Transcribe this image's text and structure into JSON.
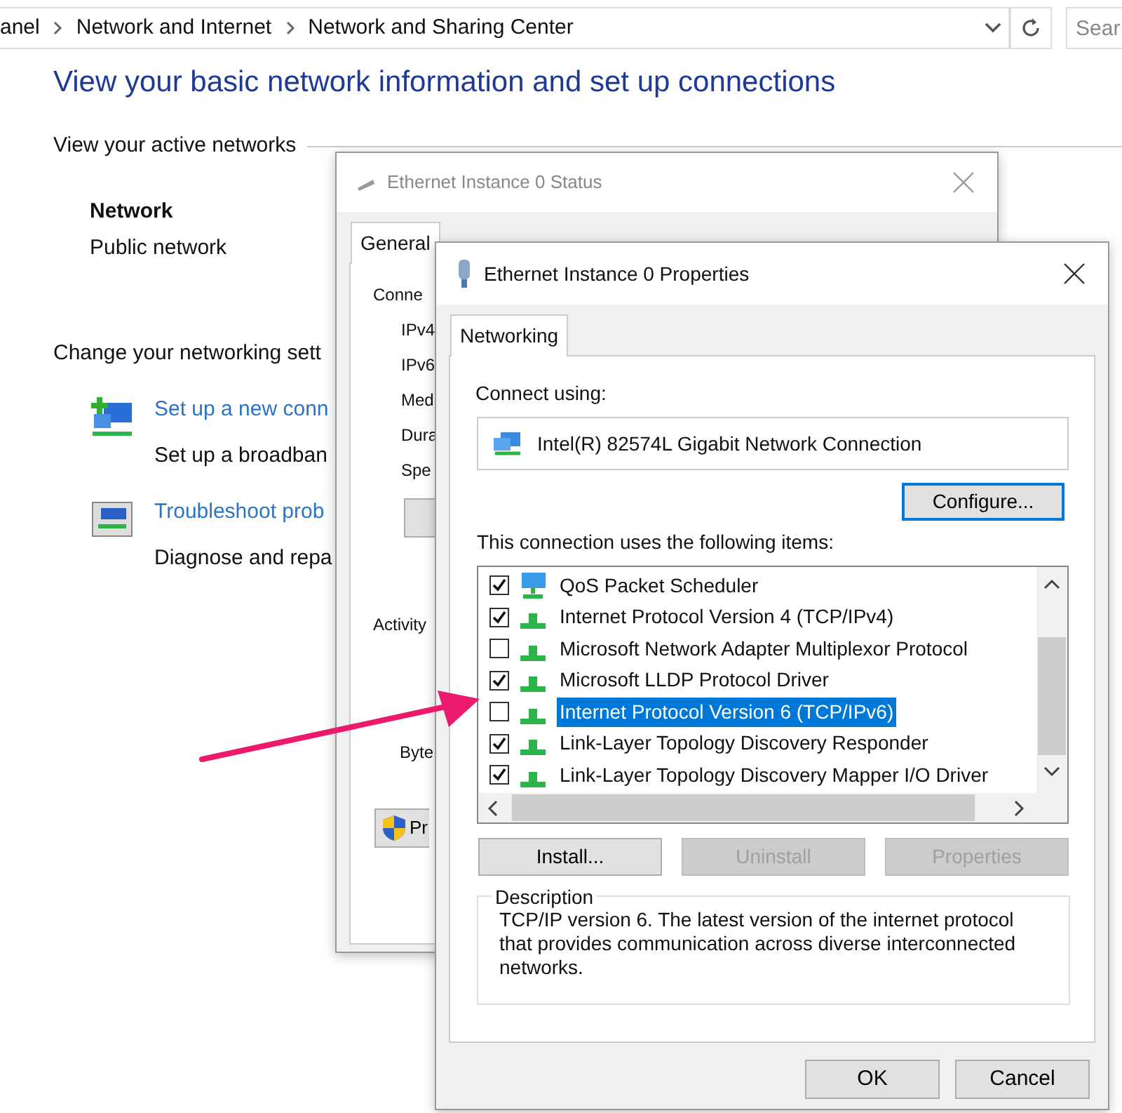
{
  "address_bar": {
    "breadcrumbs": [
      "anel",
      "Network and Internet",
      "Network and Sharing Center"
    ],
    "search_placeholder": "Sear"
  },
  "page": {
    "heading": "View your basic network information and set up connections",
    "active_networks_label": "View your active networks",
    "network": {
      "name": "Network",
      "type": "Public network"
    },
    "change_settings_label": "Change your networking sett",
    "tasks": [
      {
        "kind": "add",
        "link": "Set up a new conn",
        "description": "Set up a broadban"
      },
      {
        "kind": "repair",
        "link": "Troubleshoot prob",
        "description": "Diagnose and repa"
      }
    ]
  },
  "status_dialog": {
    "title": "Ethernet Instance 0 Status",
    "tabs": [
      {
        "label": "General",
        "selected": true
      }
    ],
    "section_label": "Conne",
    "rows": [
      "IPv4",
      "IPv6",
      "Med",
      "Dura",
      "Spe"
    ],
    "activity_label": "Activity",
    "bytes_label": "Byte",
    "shield_button": "Pr"
  },
  "properties_dialog": {
    "title": "Ethernet Instance 0 Properties",
    "tabs": [
      {
        "label": "Networking",
        "selected": true
      }
    ],
    "connect_using_label": "Connect using:",
    "adapter": "Intel(R) 82574L Gigabit Network Connection",
    "configure_button": {
      "label": "Configure...",
      "focused": true
    },
    "items_label": "This connection uses the following items:",
    "items": [
      {
        "kind": "service",
        "label": "QoS Packet Scheduler",
        "checked": true,
        "selected": false
      },
      {
        "kind": "protocol",
        "label": "Internet Protocol Version 4 (TCP/IPv4)",
        "checked": true,
        "selected": false
      },
      {
        "kind": "protocol",
        "label": "Microsoft Network Adapter Multiplexor Protocol",
        "checked": false,
        "selected": false
      },
      {
        "kind": "protocol",
        "label": "Microsoft LLDP Protocol Driver",
        "checked": true,
        "selected": false
      },
      {
        "kind": "protocol",
        "label": "Internet Protocol Version 6 (TCP/IPv6)",
        "checked": false,
        "selected": true
      },
      {
        "kind": "protocol",
        "label": "Link-Layer Topology Discovery Responder",
        "checked": true,
        "selected": false
      },
      {
        "kind": "protocol",
        "label": "Link-Layer Topology Discovery Mapper I/O Driver",
        "checked": true,
        "selected": false
      }
    ],
    "item_buttons": [
      {
        "label": "Install...",
        "disabled": false
      },
      {
        "label": "Uninstall",
        "disabled": true
      },
      {
        "label": "Properties",
        "disabled": true
      }
    ],
    "description_label": "Description",
    "description": "TCP/IP version 6. The latest version of the internet protocol that provides communication across diverse interconnected networks.",
    "dialog_buttons": [
      "OK",
      "Cancel"
    ]
  }
}
